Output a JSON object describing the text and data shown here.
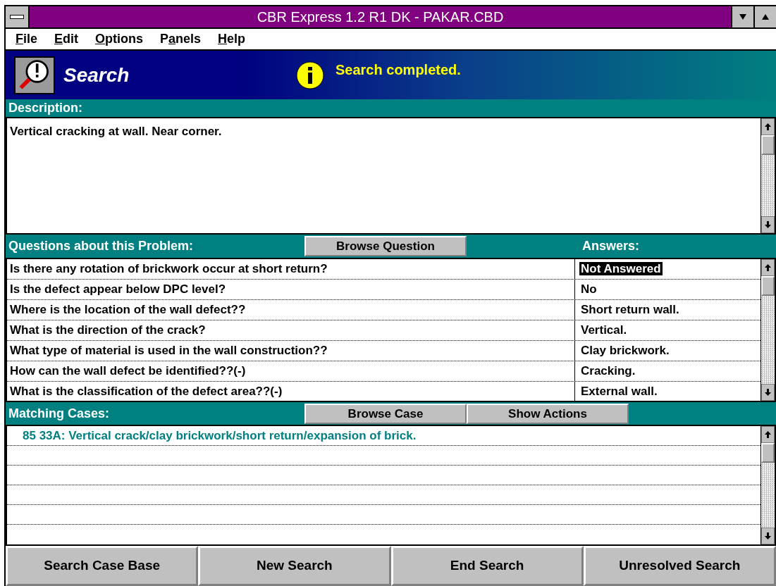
{
  "window": {
    "title": "CBR Express 1.2 R1 DK - PAKAR.CBD"
  },
  "menu": [
    {
      "access_key": "F",
      "rest": "ile"
    },
    {
      "access_key": "E",
      "rest": "dit"
    },
    {
      "access_key": "O",
      "rest": "ptions"
    },
    {
      "lead": "P",
      "access_key": "a",
      "rest": "nels"
    },
    {
      "access_key": "H",
      "rest": "elp"
    }
  ],
  "banner": {
    "title": "Search",
    "status": "Search completed."
  },
  "description": {
    "label": "Description:",
    "text": "Vertical cracking at wall.  Near corner."
  },
  "questions": {
    "label": "Questions about this Problem:",
    "button": "Browse Question",
    "answers_label": "Answers:",
    "rows": [
      {
        "question": "Is there any rotation of brickwork occur at short return?",
        "answer": "Not Answered",
        "selected": true
      },
      {
        "question": "Is the defect appear below DPC level?",
        "answer": "No",
        "selected": false
      },
      {
        "question": "Where is the location of the wall defect??",
        "answer": "Short return wall.",
        "selected": false
      },
      {
        "question": "What is the direction of the crack?",
        "answer": "Vertical.",
        "selected": false
      },
      {
        "question": "What type of material is used in the wall construction??",
        "answer": "Clay brickwork.",
        "selected": false
      },
      {
        "question": "How can the wall defect be identified??(-)",
        "answer": "Cracking.",
        "selected": false
      },
      {
        "question": "What is the classification of the defect area??(-)",
        "answer": "External wall.",
        "selected": false
      }
    ]
  },
  "matching_cases": {
    "label": "Matching Cases:",
    "buttons": [
      "Browse Case",
      "Show Actions"
    ],
    "cases": [
      "85 33A: Vertical crack/clay brickwork/short return/expansion of brick."
    ]
  },
  "buttons": [
    "Search Case Base",
    "New Search",
    "End Search",
    "Unresolved Search"
  ]
}
